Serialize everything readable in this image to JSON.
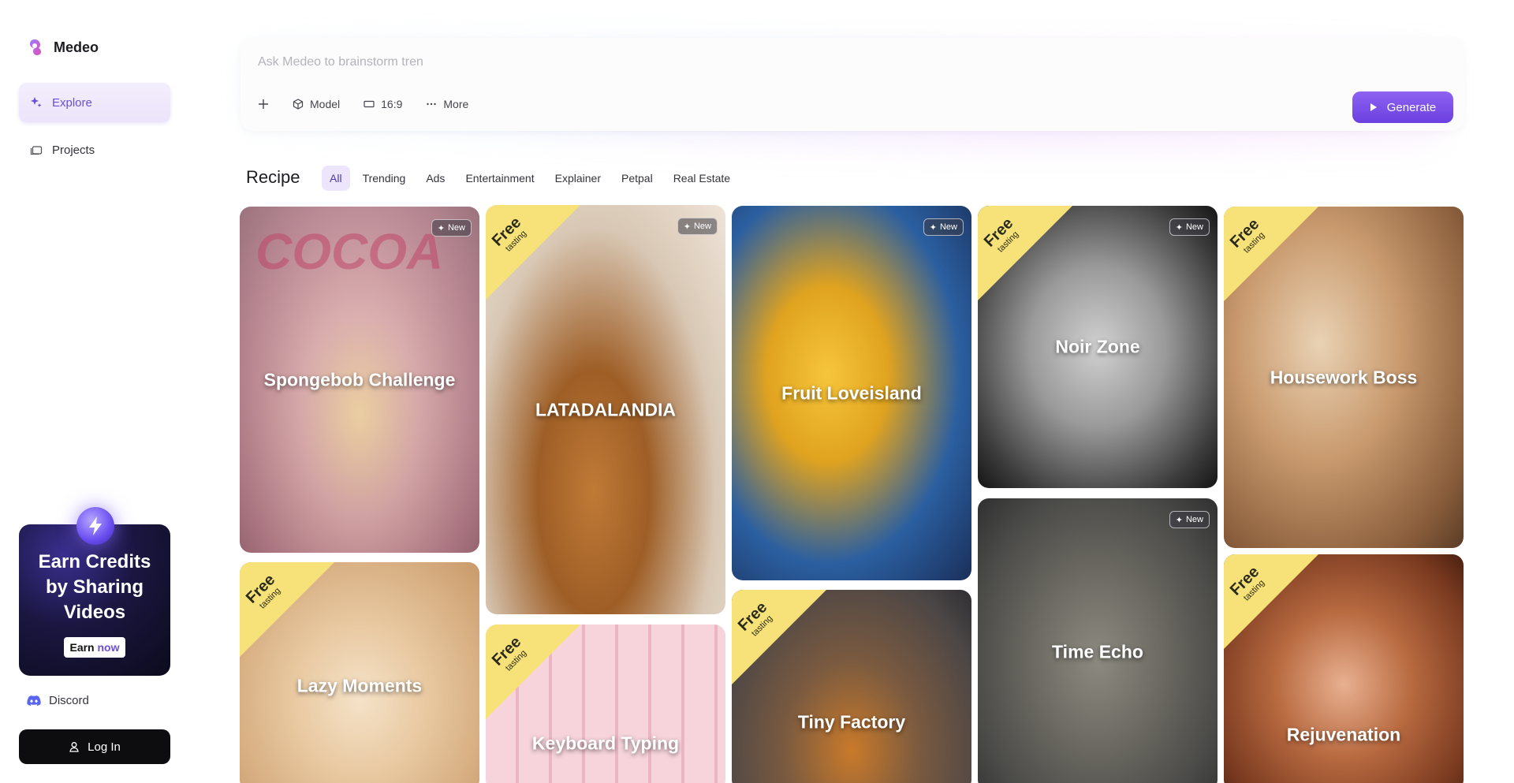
{
  "app": {
    "name": "Medeo"
  },
  "sidebar": {
    "items": [
      {
        "label": "Explore",
        "active": true
      },
      {
        "label": "Projects",
        "active": false
      }
    ],
    "promo": {
      "title": "Earn Credits by Sharing Videos",
      "button_prefix": "Earn ",
      "button_highlight": "now"
    },
    "discord_label": "Discord",
    "login_label": "Log In"
  },
  "prompt": {
    "placeholder": "Ask Medeo to brainstorm tren",
    "tools": {
      "model": "Model",
      "ratio": "16:9",
      "more": "More"
    },
    "generate_label": "Generate"
  },
  "recipe": {
    "title": "Recipe",
    "tabs": [
      "All",
      "Trending",
      "Ads",
      "Entertainment",
      "Explainer",
      "Petpal",
      "Real Estate"
    ],
    "active_tab": "All"
  },
  "badges": {
    "new": "New",
    "free": "Free",
    "free_sub": "tasting"
  },
  "cards": [
    {
      "title": "Spongebob Challenge",
      "badge": "new"
    },
    {
      "title": "Lazy Moments",
      "badge": "free"
    },
    {
      "title": "LATADALANDIA",
      "badge": "both"
    },
    {
      "title": "Keyboard Typing",
      "badge": "free"
    },
    {
      "title": "Fruit Loveisland",
      "badge": "new"
    },
    {
      "title": "Tiny Factory",
      "badge": "free"
    },
    {
      "title": "Noir Zone",
      "badge": "both"
    },
    {
      "title": "Time Echo",
      "badge": "new"
    },
    {
      "title": "Housework Boss",
      "badge": "free"
    },
    {
      "title": "Rejuvenation",
      "badge": "free"
    }
  ],
  "colors": {
    "accent": "#6c3fe0",
    "ribbon": "#f7e27a"
  }
}
